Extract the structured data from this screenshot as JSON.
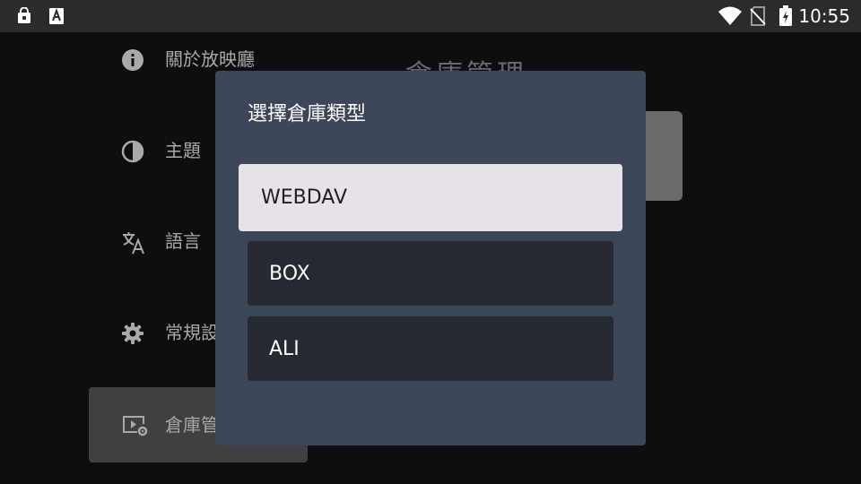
{
  "status_bar": {
    "time": "10:55",
    "left_icons": [
      "lock-bag-icon",
      "font-a-icon"
    ],
    "right_icons": [
      "wifi-icon",
      "no-sim-icon",
      "battery-charging-icon"
    ]
  },
  "settings_menu": {
    "items": [
      {
        "label": "關於放映廳",
        "icon": "info-icon"
      },
      {
        "label": "主題",
        "icon": "contrast-icon"
      },
      {
        "label": "語言",
        "icon": "translate-icon"
      },
      {
        "label": "常規設",
        "icon": "gear-icon"
      },
      {
        "label": "倉庫管",
        "icon": "video-settings-icon",
        "selected": true
      }
    ]
  },
  "page": {
    "title": "倉庫管理"
  },
  "dialog": {
    "title": "選擇倉庫類型",
    "options": [
      {
        "label": "WEBDAV",
        "focused": true
      },
      {
        "label": "BOX"
      },
      {
        "label": "ALI"
      }
    ]
  },
  "colors": {
    "status_bar_bg": "#2b2b2b",
    "screen_bg": "#0e0e0e",
    "dialog_bg": "#3d4659",
    "option_bg": "#252a31",
    "option_focused_bg": "#e6e2e7",
    "menu_selected_bg": "#404040"
  }
}
